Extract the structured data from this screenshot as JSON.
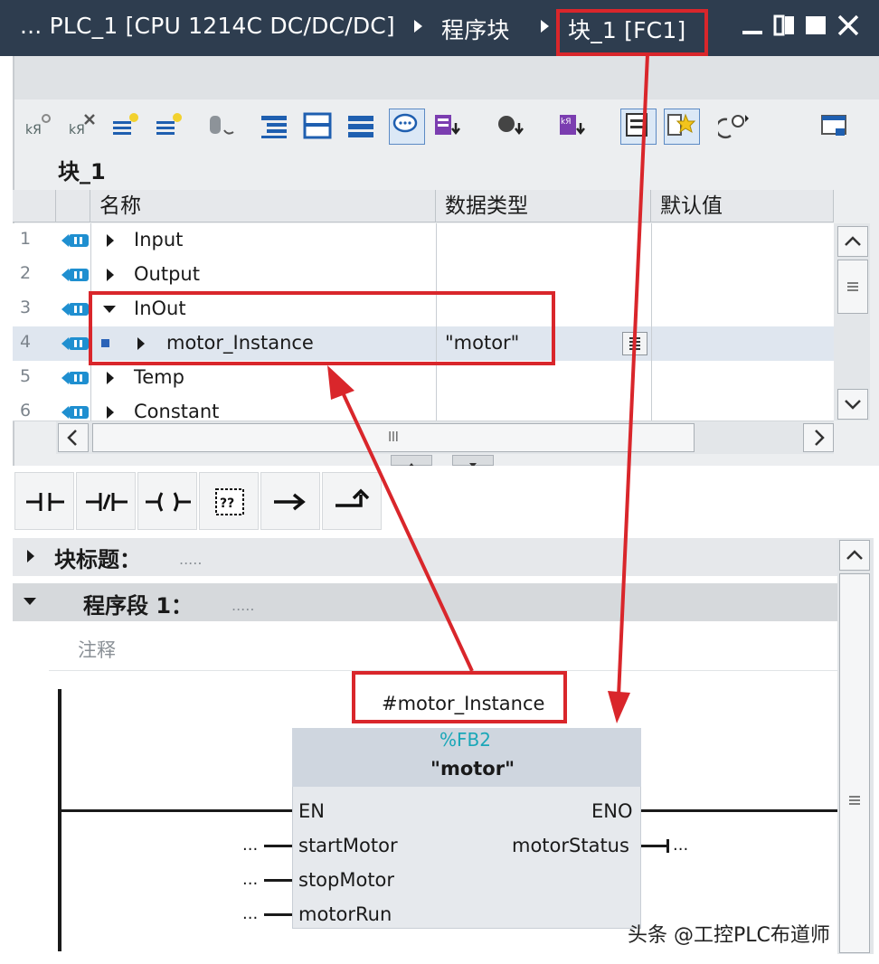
{
  "titlebar": {
    "crumb_1": "... PLC_1 [CPU 1214C DC/DC/DC]",
    "crumb_2": "程序块",
    "crumb_3": "块_1 [FC1]",
    "minimize_icon": "minimize-icon",
    "tile_icon": "tile-window-icon",
    "maximize_icon": "maximize-icon",
    "close_icon": "close-icon"
  },
  "toolbar": {
    "icons": [
      "insert-network-icon",
      "delete-network-icon",
      "insert-row-icon",
      "add-row-icon",
      "absolute-operands-icon",
      "network-list-icon",
      "open-all-networks-icon",
      "close-networks-icon",
      "comments-icon",
      "symbol-info-icon",
      "tag-info-icon",
      "memory-info-icon",
      "free-comment-icon",
      "favorites-icon",
      "monitoring-icon",
      "block-interface-icon"
    ]
  },
  "block": {
    "name": "块_1"
  },
  "interface": {
    "headers": {
      "name": "名称",
      "datatype": "数据类型",
      "default": "默认值"
    },
    "rows": [
      {
        "num": "1",
        "name": "Input",
        "datatype": "",
        "expanded": false
      },
      {
        "num": "2",
        "name": "Output",
        "datatype": "",
        "expanded": false
      },
      {
        "num": "3",
        "name": "InOut",
        "datatype": "",
        "expanded": true
      },
      {
        "num": "4",
        "name": "motor_Instance",
        "datatype": "\"motor\"",
        "expanded": false
      },
      {
        "num": "5",
        "name": "Temp",
        "datatype": "",
        "expanded": false
      },
      {
        "num": "6",
        "name": "Constant",
        "datatype": "",
        "expanded": false
      }
    ],
    "hscroll_grip": "lll"
  },
  "lad_instructions": [
    "normally-open-contact-icon",
    "normally-closed-contact-icon",
    "coil-icon",
    "empty-box-icon",
    "open-branch-icon",
    "close-branch-icon"
  ],
  "editor": {
    "block_title_label": "块标题：",
    "block_title_value": ".....",
    "network_label": "程序段 1：",
    "network_value": ".....",
    "comment_placeholder": "注释"
  },
  "fb_call": {
    "instance": "#motor_Instance",
    "fb_number": "%FB2",
    "fb_name": "\"motor\"",
    "en": "EN",
    "eno": "ENO",
    "inputs": [
      "startMotor",
      "stopMotor",
      "motorRun"
    ],
    "outputs": [
      "motorStatus"
    ],
    "input_placeholder": "...",
    "output_placeholder": "..."
  },
  "colors": {
    "titlebar_bg": "#2e3d4f",
    "highlight_red": "#d9262b",
    "fb_number_color": "#1aa7b8"
  },
  "watermark": "头条 @工控PLC布道师"
}
